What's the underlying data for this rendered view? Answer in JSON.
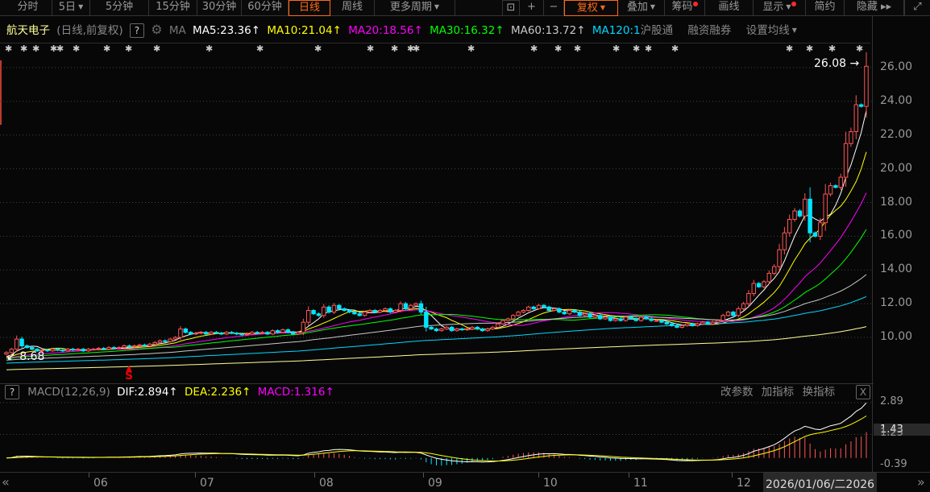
{
  "toolbar": {
    "left": [
      {
        "label": "分时"
      },
      {
        "label": "5日",
        "dropdown": true
      },
      {
        "label": "5分钟"
      },
      {
        "label": "15分钟"
      },
      {
        "label": "30分钟"
      },
      {
        "label": "60分钟"
      },
      {
        "label": "日线",
        "active": true
      },
      {
        "label": "周线"
      },
      {
        "label": "更多周期",
        "dropdown": true
      }
    ],
    "right": [
      {
        "label": "+"
      },
      {
        "label": "−"
      },
      {
        "label": "复权",
        "dropdown": true,
        "active": true
      },
      {
        "label": "叠加",
        "dropdown": true
      },
      {
        "label": "筹码",
        "dot": true
      },
      {
        "label": "画线"
      },
      {
        "label": "显示",
        "dropdown": true,
        "dot": true
      },
      {
        "label": "简约"
      },
      {
        "label": "隐藏 ▸▸"
      }
    ]
  },
  "header": {
    "stock_name": "航天电子",
    "mode": "(日线,前复权)",
    "help": "?",
    "ma_label": "MA",
    "ma5": "MA5:23.36",
    "ma10": "MA10:21.04",
    "ma20": "MA20:18.56",
    "ma30": "MA30:16.32",
    "ma60": "MA60:13.72",
    "ma120": "MA120:1",
    "arrow": "↑",
    "links": [
      "沪股通",
      "融资融券",
      "设置均线"
    ]
  },
  "price_axis": [
    "26.00",
    "24.00",
    "22.00",
    "20.00",
    "18.00",
    "16.00",
    "14.00",
    "12.00",
    "10.00"
  ],
  "annotations": {
    "high": "26.08",
    "low": "8.68",
    "signal": "S"
  },
  "macd": {
    "help": "?",
    "title": "MACD(12,26,9)",
    "dif": "DIF:2.894",
    "dea": "DEA:2.236",
    "macd": "MACD:1.316",
    "arrow": "↑",
    "actions": [
      "改参数",
      "加指标",
      "换指标"
    ],
    "close": "X",
    "axis": [
      "2.89",
      "1.43",
      "1.23",
      "-0.39"
    ]
  },
  "time_axis": {
    "months": [
      "06",
      "07",
      "08",
      "09",
      "10",
      "11",
      "12"
    ],
    "cursor_date": "2026/01/06/二",
    "year": "2026"
  },
  "colors": {
    "up": "#ff5555",
    "down": "#00e5ff",
    "ma5": "#ffffff",
    "ma10": "#ffff00",
    "ma20": "#ff00ff",
    "ma30": "#00ff00",
    "ma60": "#c8c8c8",
    "ma120": "#00d8ff",
    "ma250": "#ffff99",
    "active": "#ff6a1a"
  },
  "chart_data": {
    "type": "candlestick",
    "closes": [
      9.1,
      9.3,
      9.9,
      9.5,
      9.4,
      9.3,
      9.2,
      9.25,
      9.2,
      9.3,
      9.25,
      9.2,
      9.3,
      9.25,
      9.3,
      9.2,
      9.3,
      9.3,
      9.35,
      9.3,
      9.4,
      9.35,
      9.4,
      9.5,
      9.45,
      9.5,
      9.55,
      9.5,
      9.6,
      9.7,
      9.8,
      9.75,
      9.9,
      10.0,
      10.5,
      10.3,
      10.2,
      10.25,
      10.3,
      10.2,
      10.3,
      10.25,
      10.2,
      10.3,
      10.25,
      10.2,
      10.15,
      10.2,
      10.3,
      10.25,
      10.3,
      10.2,
      10.4,
      10.3,
      10.45,
      10.3,
      10.2,
      10.3,
      10.9,
      11.6,
      11.4,
      11.3,
      11.8,
      11.5,
      11.9,
      11.7,
      11.6,
      11.5,
      11.4,
      11.3,
      11.5,
      11.6,
      11.5,
      11.6,
      11.7,
      11.5,
      11.6,
      12.0,
      11.7,
      11.9,
      12.0,
      11.5,
      10.6,
      10.5,
      10.4,
      10.5,
      10.6,
      10.4,
      10.5,
      10.45,
      10.5,
      10.6,
      10.5,
      10.4,
      10.5,
      10.6,
      10.8,
      11.0,
      11.1,
      11.3,
      11.5,
      11.6,
      11.8,
      11.7,
      11.9,
      11.8,
      11.6,
      11.7,
      11.5,
      11.4,
      11.6,
      11.5,
      11.3,
      11.4,
      11.2,
      11.3,
      11.1,
      11.2,
      11.0,
      11.1,
      11.0,
      11.2,
      11.1,
      11.0,
      11.2,
      11.1,
      11.0,
      11.0,
      10.9,
      10.8,
      10.7,
      10.6,
      10.7,
      10.8,
      10.7,
      10.8,
      10.9,
      10.8,
      10.9,
      11.0,
      11.3,
      11.5,
      11.3,
      11.7,
      12.0,
      12.6,
      13.2,
      13.0,
      13.3,
      13.8,
      14.2,
      15.2,
      16.2,
      17.0,
      17.5,
      17.2,
      18.2,
      16.2,
      16.0,
      16.8,
      18.5,
      19.0,
      18.9,
      19.5,
      21.5,
      22.2,
      23.8,
      23.7,
      26.08
    ],
    "ylim": [
      10,
      26
    ],
    "macd_ylim": [
      -0.39,
      2.89
    ],
    "ma_periods": [
      5,
      10,
      20,
      30,
      60,
      120,
      250
    ]
  }
}
